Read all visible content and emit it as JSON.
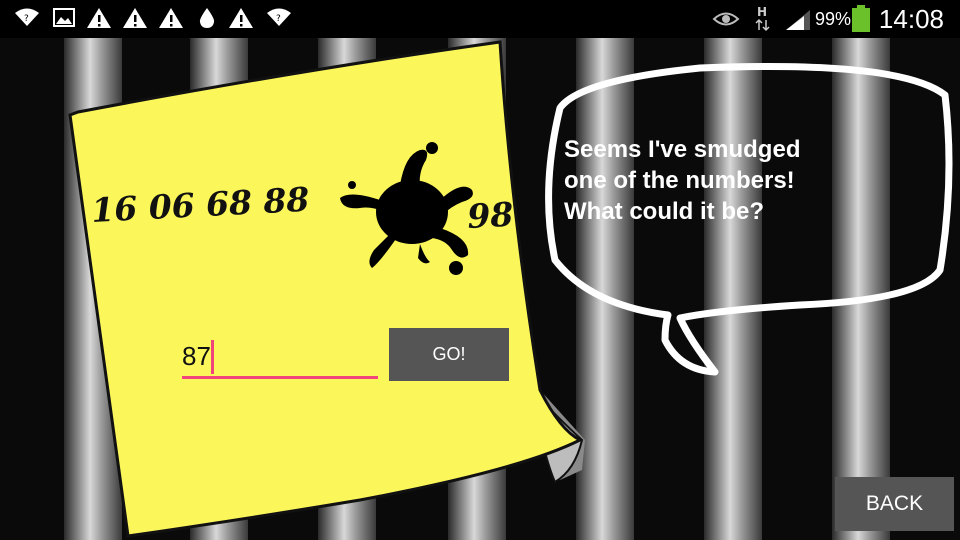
{
  "status_bar": {
    "left_icons": [
      "wifi-icon",
      "image-icon",
      "warning-icon",
      "warning-icon",
      "warning-icon",
      "water-drop-icon",
      "warning-icon",
      "wifi-icon"
    ],
    "right_icons": [
      "eye-icon",
      "h-network-icon",
      "signal-icon"
    ],
    "battery_percent": "99%",
    "time": "14:08",
    "battery_color": "#6bc12a"
  },
  "note": {
    "code_prefix": "16 06 68 88",
    "code_suffix": "98",
    "color": "#fbf65a"
  },
  "guess": {
    "value": "87"
  },
  "go_button": {
    "label": "GO!"
  },
  "speech_bubble": {
    "text": "Seems I've smudged\none of the numbers!\nWhat could it be?"
  },
  "back_button": {
    "label": "BACK"
  },
  "colors": {
    "input_underline": "#f0447a",
    "button_bg": "#555555"
  }
}
